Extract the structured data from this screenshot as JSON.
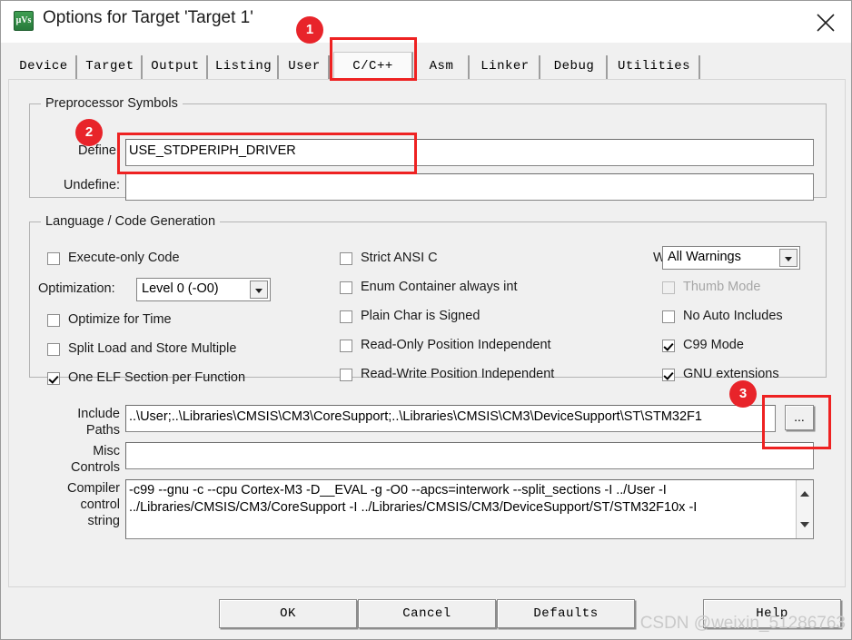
{
  "window": {
    "title": "Options for Target 'Target 1'",
    "icon": "uvision-logo-icon",
    "close_label": "close-icon"
  },
  "tabs": [
    {
      "label": "Device",
      "selected": false
    },
    {
      "label": "Target",
      "selected": false
    },
    {
      "label": "Output",
      "selected": false
    },
    {
      "label": "Listing",
      "selected": false
    },
    {
      "label": "User",
      "selected": false
    },
    {
      "label": "C/C++",
      "selected": true
    },
    {
      "label": "Asm",
      "selected": false
    },
    {
      "label": "Linker",
      "selected": false
    },
    {
      "label": "Debug",
      "selected": false
    },
    {
      "label": "Utilities",
      "selected": false
    }
  ],
  "preprocessor": {
    "group_title": "Preprocessor Symbols",
    "define_label": "Define:",
    "define_value": "USE_STDPERIPH_DRIVER",
    "undefine_label": "Undefine:",
    "undefine_value": ""
  },
  "language": {
    "group_title": "Language / Code Generation",
    "col1": [
      {
        "label": "Execute-only Code",
        "checked": false,
        "disabled": false
      },
      {
        "label": "Optimize for Time",
        "checked": false,
        "disabled": false
      },
      {
        "label": "Split Load and Store Multiple",
        "checked": false,
        "disabled": false
      },
      {
        "label": "One ELF Section per Function",
        "checked": true,
        "disabled": false
      }
    ],
    "optimization_label": "Optimization:",
    "optimization_value": "Level 0 (-O0)",
    "col2": [
      {
        "label": "Strict ANSI C",
        "checked": false,
        "disabled": false
      },
      {
        "label": "Enum Container always int",
        "checked": false,
        "disabled": false
      },
      {
        "label": "Plain Char is Signed",
        "checked": false,
        "disabled": false
      },
      {
        "label": "Read-Only Position Independent",
        "checked": false,
        "disabled": false
      },
      {
        "label": "Read-Write Position Independent",
        "checked": false,
        "disabled": false
      }
    ],
    "warnings_label": "Warnings:",
    "warnings_value": "All Warnings",
    "col3": [
      {
        "label": "Thumb Mode",
        "checked": false,
        "disabled": true
      },
      {
        "label": "No Auto Includes",
        "checked": false,
        "disabled": false
      },
      {
        "label": "C99 Mode",
        "checked": true,
        "disabled": false
      },
      {
        "label": "GNU extensions",
        "checked": true,
        "disabled": false
      }
    ]
  },
  "paths": {
    "include_label_1": "Include",
    "include_label_2": "Paths",
    "include_value": "..\\User;..\\Libraries\\CMSIS\\CM3\\CoreSupport;..\\Libraries\\CMSIS\\CM3\\DeviceSupport\\ST\\STM32F1",
    "browse_label": "...",
    "misc_label_1": "Misc",
    "misc_label_2": "Controls",
    "misc_value": "",
    "compiler_label_1": "Compiler",
    "compiler_label_2": "control",
    "compiler_label_3": "string",
    "compiler_value": "-c99 --gnu -c --cpu Cortex-M3 -D__EVAL -g -O0 --apcs=interwork --split_sections -I ../User -I ../Libraries/CMSIS/CM3/CoreSupport -I ../Libraries/CMSIS/CM3/DeviceSupport/ST/STM32F10x -I",
    "scroll_up": "scroll-up-arrow",
    "scroll_down": "scroll-down-arrow"
  },
  "footer": {
    "ok": "OK",
    "cancel": "Cancel",
    "defaults": "Defaults",
    "help": "Help"
  },
  "annotations": {
    "badge1": "1",
    "badge2": "2",
    "badge3": "3",
    "accent_color": "#e8242a"
  },
  "watermark": "CSDN @weixin_51286763"
}
